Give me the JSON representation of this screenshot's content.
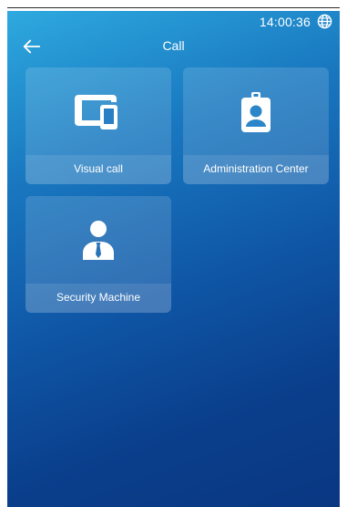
{
  "status": {
    "time": "14:00:36",
    "globe_icon": "globe-icon"
  },
  "header": {
    "title": "Call",
    "back_icon": "back-arrow-icon"
  },
  "tiles": [
    {
      "label": "Visual call",
      "icon": "devices-icon"
    },
    {
      "label": "Administration Center",
      "icon": "id-badge-icon"
    },
    {
      "label": "Security Machine",
      "icon": "security-person-icon"
    }
  ],
  "colors": {
    "accent": "#1978c0",
    "text": "#ffffff"
  }
}
